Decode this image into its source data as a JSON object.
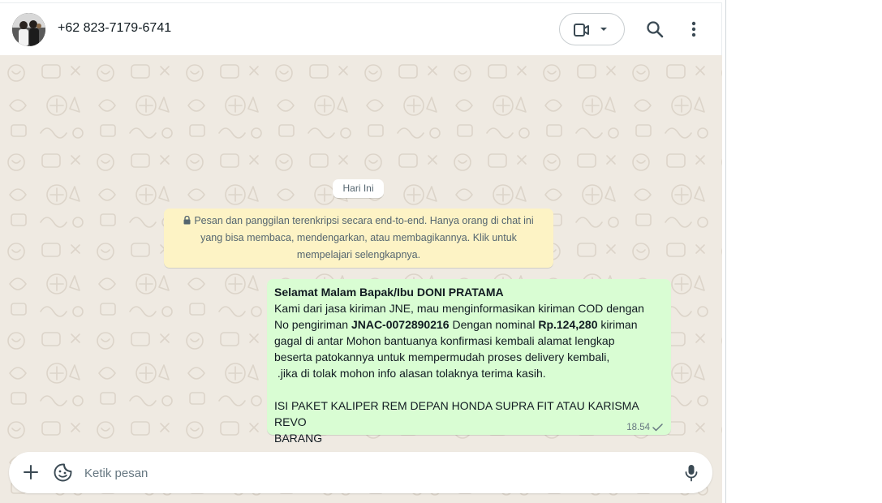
{
  "header": {
    "contact_name": "+62 823-7179-6741",
    "icons": [
      "avatar",
      "video-call-icon",
      "chevron-down-icon",
      "search-icon",
      "menu-icon"
    ]
  },
  "chat": {
    "day_label": "Hari Ini",
    "encryption_notice": "Pesan dan panggilan terenkripsi secara end-to-end. Hanya orang di chat ini yang bisa membaca, mendengarkan, atau membagikannya. Klik untuk mempelajari selengkapnya.",
    "message": {
      "greeting": "Selamat Malam Bapak/Ibu DONI PRATAMA",
      "text1": "Kami dari jasa kiriman JNE, mau menginformasikan kiriman COD dengan\nNo pengiriman ",
      "tracking": "JNAC-0072890216",
      "text2": " Dengan nominal ",
      "amount": "Rp.124,280",
      "text3": " kiriman\ngagal di antar Mohon bantuanya konfirmasi kembali alamat lengkap\nbeserta patokannya untuk mempermudah proses delivery kembali,\n .jika di tolak mohon info alasan tolaknya terima kasih.\n\nISI PAKET KALIPER REM DEPAN HONDA SUPRA FIT ATAU KARISMA REVO\nBARANG",
      "time": "18.54",
      "status": "sent-check"
    }
  },
  "composer": {
    "placeholder": "Ketik pesan",
    "icons": [
      "plus-icon",
      "sticker-icon",
      "microphone-icon"
    ]
  },
  "colors": {
    "chat_bg": "#efeae2",
    "outgoing_bubble": "#d9fdd3",
    "notice_bg": "#fdf3c5",
    "icon": "#3b4a54"
  }
}
